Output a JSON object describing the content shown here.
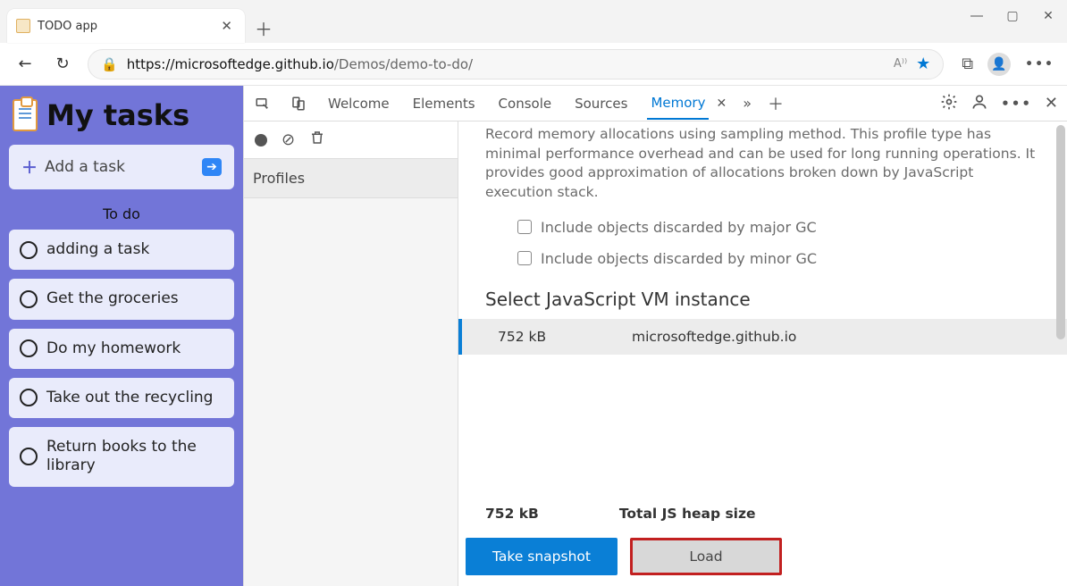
{
  "browser": {
    "tab_title": "TODO app",
    "url_domain": "https://microsoftedge.github.io",
    "url_path": "/Demos/demo-to-do/"
  },
  "todo": {
    "title": "My tasks",
    "add_label": "Add a task",
    "section_label": "To do",
    "items": [
      {
        "text": "adding a task"
      },
      {
        "text": "Get the groceries"
      },
      {
        "text": "Do my homework"
      },
      {
        "text": "Take out the recycling"
      },
      {
        "text": "Return books to the library"
      }
    ]
  },
  "devtools": {
    "tabs": {
      "welcome": "Welcome",
      "elements": "Elements",
      "console": "Console",
      "sources": "Sources",
      "memory": "Memory"
    },
    "profiles_label": "Profiles",
    "memory": {
      "description": "Record memory allocations using sampling method. This profile type has minimal performance overhead and can be used for long running operations. It provides good approximation of allocations broken down by JavaScript execution stack.",
      "check_major": "Include objects discarded by major GC",
      "check_minor": "Include objects discarded by minor GC",
      "vm_heading": "Select JavaScript VM instance",
      "vm_row": {
        "size": "752 kB",
        "origin": "microsoftedge.github.io"
      },
      "footer_size": "752 kB",
      "footer_label": "Total JS heap size",
      "snapshot_label": "Take snapshot",
      "load_label": "Load"
    }
  }
}
